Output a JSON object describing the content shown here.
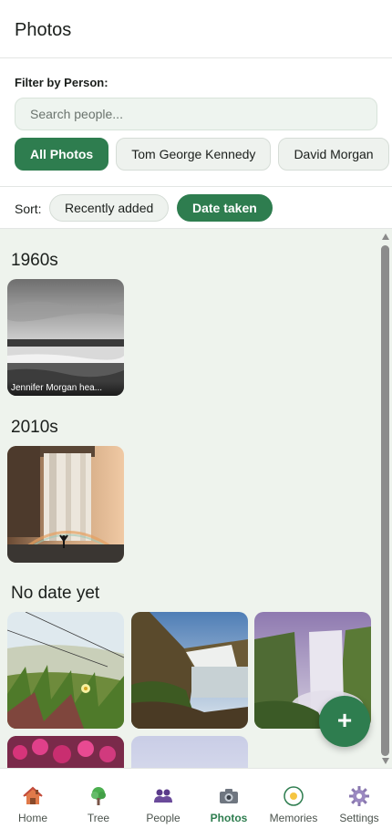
{
  "header": {
    "title": "Photos"
  },
  "filter": {
    "label": "Filter by Person:",
    "search_placeholder": "Search people...",
    "chips": [
      {
        "label": "All Photos",
        "active": true
      },
      {
        "label": "Tom George Kennedy",
        "active": false
      },
      {
        "label": "David Morgan",
        "active": false
      }
    ]
  },
  "sort": {
    "label": "Sort:",
    "options": [
      {
        "label": "Recently added",
        "active": false
      },
      {
        "label": "Date taken",
        "active": true
      }
    ]
  },
  "sections": [
    {
      "title": "1960s",
      "photos": [
        {
          "caption": "Jennifer Morgan hea..."
        }
      ]
    },
    {
      "title": "2010s"
    },
    {
      "title": "No date yet"
    }
  ],
  "fab": {
    "label": "+"
  },
  "nav": {
    "items": [
      {
        "label": "Home",
        "icon": "house-icon"
      },
      {
        "label": "Tree",
        "icon": "tree-icon"
      },
      {
        "label": "People",
        "icon": "people-icon"
      },
      {
        "label": "Photos",
        "icon": "camera-icon",
        "active": true
      },
      {
        "label": "Memories",
        "icon": "memories-icon"
      },
      {
        "label": "Settings",
        "icon": "gear-icon"
      }
    ]
  },
  "colors": {
    "accent": "#2e7d4f",
    "content_bg": "#eef3ed"
  }
}
